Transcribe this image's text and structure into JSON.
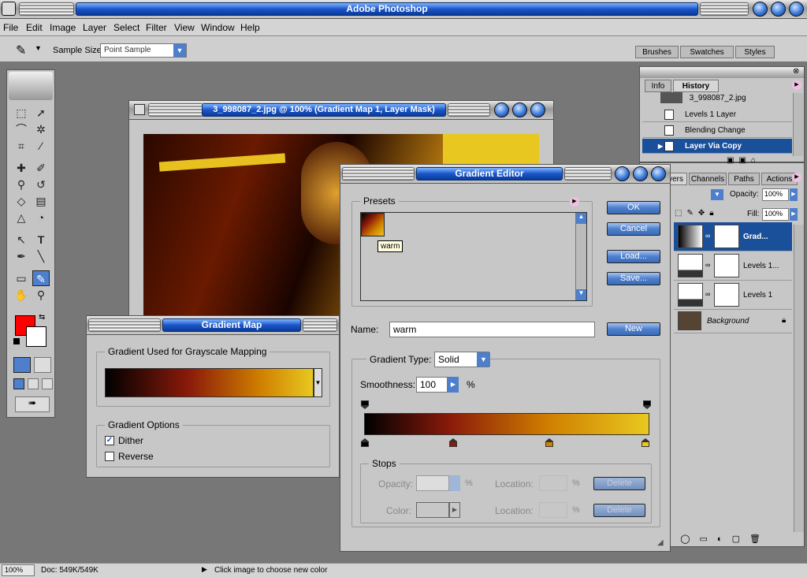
{
  "app": {
    "title": "Adobe Photoshop"
  },
  "menu": [
    "File",
    "Edit",
    "Image",
    "Layer",
    "Select",
    "Filter",
    "View",
    "Window",
    "Help"
  ],
  "options": {
    "sample_size_label": "Sample Size:",
    "sample_size_value": "Point Sample"
  },
  "palette_tabs_top": [
    "Brushes",
    "Swatches",
    "Styles"
  ],
  "document": {
    "title": "3_998087_2.jpg @ 100% (Gradient Map 1, Layer Mask)"
  },
  "gradient_map": {
    "title": "Gradient Map",
    "group1": "Gradient Used for Grayscale Mapping",
    "group2": "Gradient Options",
    "dither": "Dither",
    "reverse": "Reverse",
    "dither_checked": true,
    "reverse_checked": false
  },
  "gradient_editor": {
    "title": "Gradient Editor",
    "presets_label": "Presets",
    "tooltip": "warm",
    "buttons": {
      "ok": "OK",
      "cancel": "Cancel",
      "load": "Load...",
      "save": "Save...",
      "new": "New"
    },
    "name_label": "Name:",
    "name_value": "warm",
    "type_label": "Gradient Type:",
    "type_value": "Solid",
    "smooth_label": "Smoothness:",
    "smooth_value": "100",
    "pct": "%",
    "stops_label": "Stops",
    "opacity_label": "Opacity:",
    "color_label": "Color:",
    "location_label": "Location:",
    "delete_label": "Delete"
  },
  "history": {
    "tabs": [
      "Info",
      "History"
    ],
    "snapshot": "3_998087_2.jpg",
    "items": [
      "Levels 1 Layer",
      "Blending Change",
      "Layer Via Copy"
    ]
  },
  "layers": {
    "tabs": [
      "Layers",
      "Channels",
      "Paths",
      "Actions"
    ],
    "opacity_label": "Opacity:",
    "opacity_value": "100%",
    "fill_label": "Fill:",
    "fill_value": "100%",
    "items": [
      "Grad...",
      "Levels 1...",
      "Levels 1",
      "Background"
    ]
  },
  "status": {
    "zoom": "100%",
    "doc": "Doc: 549K/549K",
    "hint": "Click image to choose new color"
  },
  "colors": {
    "foreground": "#ff0000",
    "background": "#ffffff",
    "accent": "#1a56c8",
    "stop_colors": [
      "#000000",
      "#8a1a0a",
      "#d08000",
      "#e8c820"
    ]
  }
}
